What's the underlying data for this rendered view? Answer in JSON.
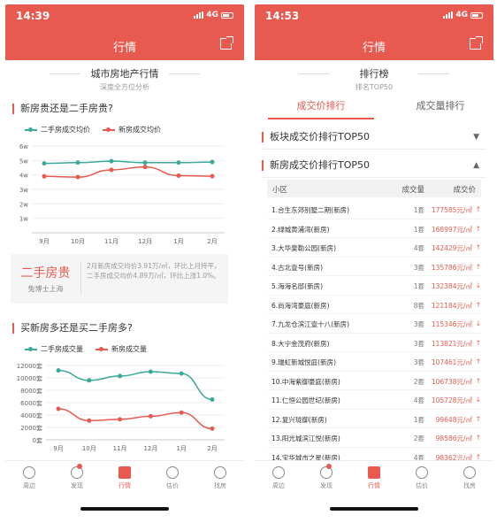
{
  "left": {
    "status_time": "14:39",
    "network": "4G",
    "nav_title": "行情",
    "header_title": "城市房地产行情",
    "header_sub": "深度全方位分析",
    "section1_title": "新房贵还是二手房贵?",
    "legend1": [
      "二手房成交均价",
      "新房成交均价"
    ],
    "price_y_ticks": [
      "6w",
      "5w",
      "4w",
      "3w",
      "2w",
      "1w"
    ],
    "months": [
      "9月",
      "10月",
      "11月",
      "12月",
      "1月",
      "2月"
    ],
    "summary_big": "二手房贵",
    "summary_small": "兔博士上海",
    "summary_text": "2月新房成交均价3.91万/㎡，环比上月持平，二手房成交均价4.89万/㎡，环比上涨1.0%。",
    "section2_title": "买新房多还是买二手房多?",
    "legend2": [
      "二手房成交量",
      "新房成交量"
    ],
    "vol_y_ticks": [
      "12000套",
      "10000套",
      "8000套",
      "6000套",
      "4000套",
      "2000套",
      "0套"
    ]
  },
  "right": {
    "status_time": "14:53",
    "network": "4G",
    "nav_title": "行情",
    "header_title": "排行榜",
    "header_sub": "排名TOP50",
    "tabs": [
      "成交价排行",
      "成交量排行"
    ],
    "fold1": "板块成交价排行TOP50",
    "fold2": "新房成交价排行TOP50",
    "caret_down": "▼",
    "caret_up": "▲",
    "table_headers": [
      "小区",
      "成交量",
      "成交价"
    ],
    "rows": [
      {
        "name": "1.合生东郊别墅二期(新房)",
        "count": "1套",
        "price": "177585元/㎡",
        "trend": "↑"
      },
      {
        "name": "2.绿城黄浦湾(新房)",
        "count": "1套",
        "price": "168997元/㎡",
        "trend": "↑"
      },
      {
        "name": "3.大华斐勒公园(新房)",
        "count": "4套",
        "price": "142429元/㎡",
        "trend": "↑"
      },
      {
        "name": "4.古北壹号(新房)",
        "count": "3套",
        "price": "135786元/㎡",
        "trend": "↑"
      },
      {
        "name": "5.海海名邸(新房)",
        "count": "1套",
        "price": "132384元/㎡",
        "trend": "↓"
      },
      {
        "name": "6.尚海湾豪庭(新房)",
        "count": "8套",
        "price": "121184元/㎡",
        "trend": "↑"
      },
      {
        "name": "7.九龙仓滨江壹十八(新房)",
        "count": "3套",
        "price": "115346元/㎡",
        "trend": "↓"
      },
      {
        "name": "8.大宁金茂府(新房)",
        "count": "3套",
        "price": "113821元/㎡",
        "trend": "↑"
      },
      {
        "name": "9.瑞虹新城悦庭(新房)",
        "count": "3套",
        "price": "107461元/㎡",
        "trend": "↑"
      },
      {
        "name": "10.中海紫御豪庭(新房)",
        "count": "2套",
        "price": "106738元/㎡",
        "trend": "↑"
      },
      {
        "name": "11.仁恒公园世纪(新房)",
        "count": "4套",
        "price": "105728元/㎡",
        "trend": "↓"
      },
      {
        "name": "12.复兴珑御(新房)",
        "count": "1套",
        "price": "99648元/㎡",
        "trend": "↑"
      },
      {
        "name": "13.阳光城滨江悦(新房)",
        "count": "2套",
        "price": "98586元/㎡",
        "trend": "↑"
      },
      {
        "name": "14.宝华城市之星(新房)",
        "count": "4套",
        "price": "98362元/㎡",
        "trend": "↑"
      }
    ]
  },
  "tabbar": [
    "周边",
    "发现",
    "行情",
    "估价",
    "找房"
  ],
  "colors": {
    "accent": "#e85a4f",
    "teal": "#3aa89a"
  },
  "chart_data": [
    {
      "type": "line",
      "title": "新房贵还是二手房贵?",
      "categories": [
        "9月",
        "10月",
        "11月",
        "12月",
        "1月",
        "2月"
      ],
      "ylim": [
        0,
        6
      ],
      "series": [
        {
          "name": "二手房成交均价",
          "values": [
            4.8,
            4.85,
            4.95,
            4.85,
            4.85,
            4.89
          ]
        },
        {
          "name": "新房成交均价",
          "values": [
            3.9,
            3.85,
            4.35,
            4.55,
            3.95,
            3.91
          ]
        }
      ]
    },
    {
      "type": "line",
      "title": "买新房多还是买二手房多?",
      "categories": [
        "9月",
        "10月",
        "11月",
        "12月",
        "1月",
        "2月"
      ],
      "ylim": [
        0,
        12000
      ],
      "series": [
        {
          "name": "二手房成交量",
          "values": [
            11200,
            9600,
            10300,
            11000,
            10700,
            6500
          ]
        },
        {
          "name": "新房成交量",
          "values": [
            5000,
            3100,
            3300,
            3800,
            4400,
            1800
          ]
        }
      ]
    }
  ]
}
